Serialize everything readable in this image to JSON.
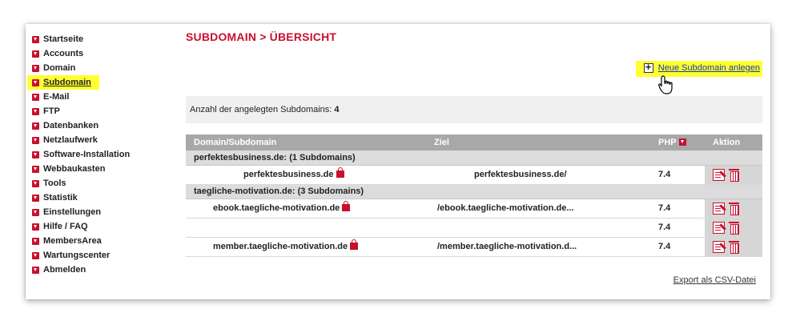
{
  "sidebar": {
    "items": [
      {
        "label": "Startseite"
      },
      {
        "label": "Accounts"
      },
      {
        "label": "Domain"
      },
      {
        "label": "Subdomain"
      },
      {
        "label": "E-Mail"
      },
      {
        "label": "FTP"
      },
      {
        "label": "Datenbanken"
      },
      {
        "label": "Netzlaufwerk"
      },
      {
        "label": "Software-Installation"
      },
      {
        "label": "Webbaukasten"
      },
      {
        "label": "Tools"
      },
      {
        "label": "Statistik"
      },
      {
        "label": "Einstellungen"
      },
      {
        "label": "Hilfe / FAQ"
      },
      {
        "label": "MembersArea"
      },
      {
        "label": "Wartungscenter"
      },
      {
        "label": "Abmelden"
      }
    ]
  },
  "page": {
    "title": "SUBDOMAIN > ÜBERSICHT",
    "new_link": "Neue Subdomain anlegen",
    "count_label": "Anzahl der angelegten Subdomains:",
    "count_value": "4",
    "export_link": "Export als CSV-Datei"
  },
  "table": {
    "headers": {
      "domain": "Domain/Subdomain",
      "target": "Ziel",
      "php": "PHP",
      "action": "Aktion"
    },
    "groups": [
      {
        "label": "perfektesbusiness.de: (1 Subdomains)",
        "rows": [
          {
            "domain": "perfektesbusiness.de",
            "target": "perfektesbusiness.de/",
            "php": "7.4"
          }
        ]
      },
      {
        "label": "taegliche-motivation.de: (3 Subdomains)",
        "rows": [
          {
            "domain": "ebook.taegliche-motivation.de",
            "target": "/ebook.taegliche-motivation.de...",
            "php": "7.4"
          },
          {
            "domain": "",
            "target": "",
            "php": "7.4"
          },
          {
            "domain": "member.taegliche-motivation.de",
            "target": "/member.taegliche-motivation.d...",
            "php": "7.4"
          }
        ]
      }
    ]
  },
  "colors": {
    "accent": "#c8102e",
    "highlight": "#ffff33",
    "header_bg": "#a8a8a8"
  }
}
